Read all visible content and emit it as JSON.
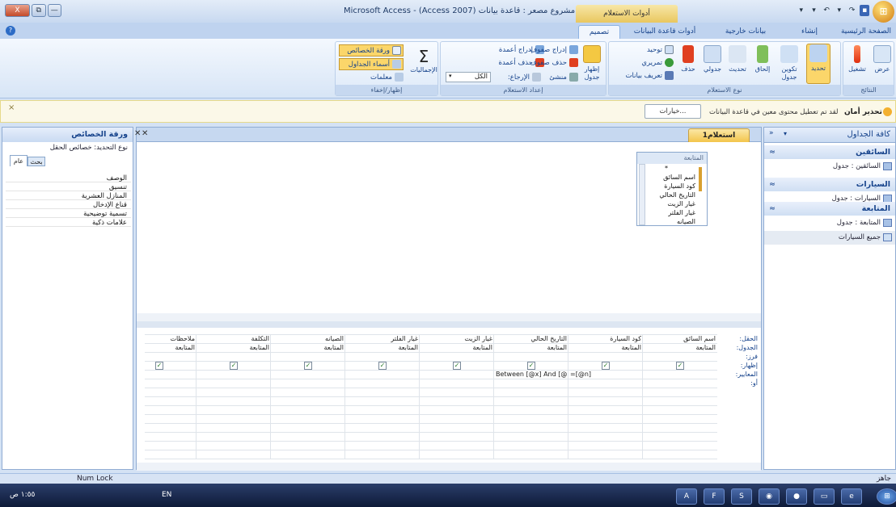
{
  "window": {
    "title": "Microsoft Access - (Access 2007) مشروع مصعر : قاعدة بيانات",
    "context_tab_label": "أدوات الاستعلام",
    "controls": {
      "close": "X",
      "restore": "⧉",
      "minimize": "—"
    },
    "office_button": "⊞",
    "qat": [
      "▾",
      "▾",
      "↶",
      "▾",
      "↷",
      "▪"
    ]
  },
  "ribbon_tabs": [
    "الصفحة الرئيسية",
    "إنشاء",
    "بيانات خارجية",
    "أدوات قاعدة البيانات",
    "تصميم"
  ],
  "ribbon": {
    "groups": [
      {
        "label": "النتائج",
        "buttons": [
          "عرض",
          "تشغيل"
        ]
      },
      {
        "label": "نوع الاستعلام",
        "buttons": [
          "تحديد",
          "تكوين جدول",
          "إلحاق",
          "تحديث",
          "جدولي",
          "حذف"
        ],
        "small": [
          "توحيد",
          "تمريري",
          "تعريف بيانات"
        ]
      },
      {
        "label": "إعداد الاستعلام",
        "buttons": [
          "إظهار جدول"
        ],
        "small": [
          "إدراج صفوف",
          "حذف صفوف",
          "منشئ",
          "إدراج أعمدة",
          "حذف أعمدة",
          "الإرجاع:",
          "الكل"
        ]
      },
      {
        "label": "إظهار/إخفاء",
        "buttons": [
          "الإجماليات"
        ],
        "small": [
          "ورقة الخصائص",
          "أسماء الجداول",
          "معلمات"
        ]
      }
    ]
  },
  "security_bar": {
    "title": "تحذير أمان",
    "message": "لقد تم تعطيل محتوى معين في قاعدة البيانات",
    "options_button": "خيارات...",
    "close": "×"
  },
  "nav_pane": {
    "title": "كافة الجداول",
    "groups": [
      {
        "name": "السائقين",
        "items": [
          "السائقين : جدول"
        ]
      },
      {
        "name": "السيارات",
        "items": [
          "السيارات : جدول"
        ]
      },
      {
        "name": "المتابعة",
        "items": [
          "المتابعة : جدول",
          "جميع السيارات"
        ]
      }
    ]
  },
  "document": {
    "tab_label": "استعلام1",
    "field_list": {
      "table": "المتابعة",
      "fields": [
        "*",
        "اسم السائق",
        "كود السيارة",
        "التاريخ الحالي",
        "غيار الزيت",
        "غيار الفلتر",
        "الصيانه"
      ]
    },
    "grid": {
      "row_labels": [
        "الحقل:",
        "الجدول:",
        "فرز:",
        "إظهار:",
        "المعايير:",
        "أو:"
      ],
      "columns": [
        {
          "field": "اسم السائق",
          "table": "المتابعة",
          "show": true,
          "criteria": ""
        },
        {
          "field": "كود السيارة",
          "table": "المتابعة",
          "show": true,
          "criteria": "=[@n]"
        },
        {
          "field": "التاريخ الحالي",
          "table": "المتابعة",
          "show": true,
          "criteria": "Between [@x] And [@y]"
        },
        {
          "field": "غيار الزيت",
          "table": "المتابعة",
          "show": true,
          "criteria": ""
        },
        {
          "field": "غيار الفلتر",
          "table": "المتابعة",
          "show": true,
          "criteria": ""
        },
        {
          "field": "الصيانه",
          "table": "المتابعة",
          "show": true,
          "criteria": ""
        },
        {
          "field": "التكلفة",
          "table": "المتابعة",
          "show": true,
          "criteria": ""
        },
        {
          "field": "ملاحظات",
          "table": "المتابعة",
          "show": true,
          "criteria": ""
        }
      ]
    }
  },
  "property_sheet": {
    "title": "ورقة الخصائص",
    "selection_type": "نوع التحديد: خصائص الحقل",
    "tabs": [
      "عام",
      "بحث"
    ],
    "rows": [
      "الوصف",
      "تنسيق",
      "المنازل العشرية",
      "قناع الإدخال",
      "تسمية توضيحية",
      "علامات ذكية"
    ]
  },
  "status_bar": {
    "left": "Num Lock",
    "right": "جاهز"
  },
  "taskbar": {
    "lang": "EN",
    "clock": "١:٥٥ ص"
  }
}
